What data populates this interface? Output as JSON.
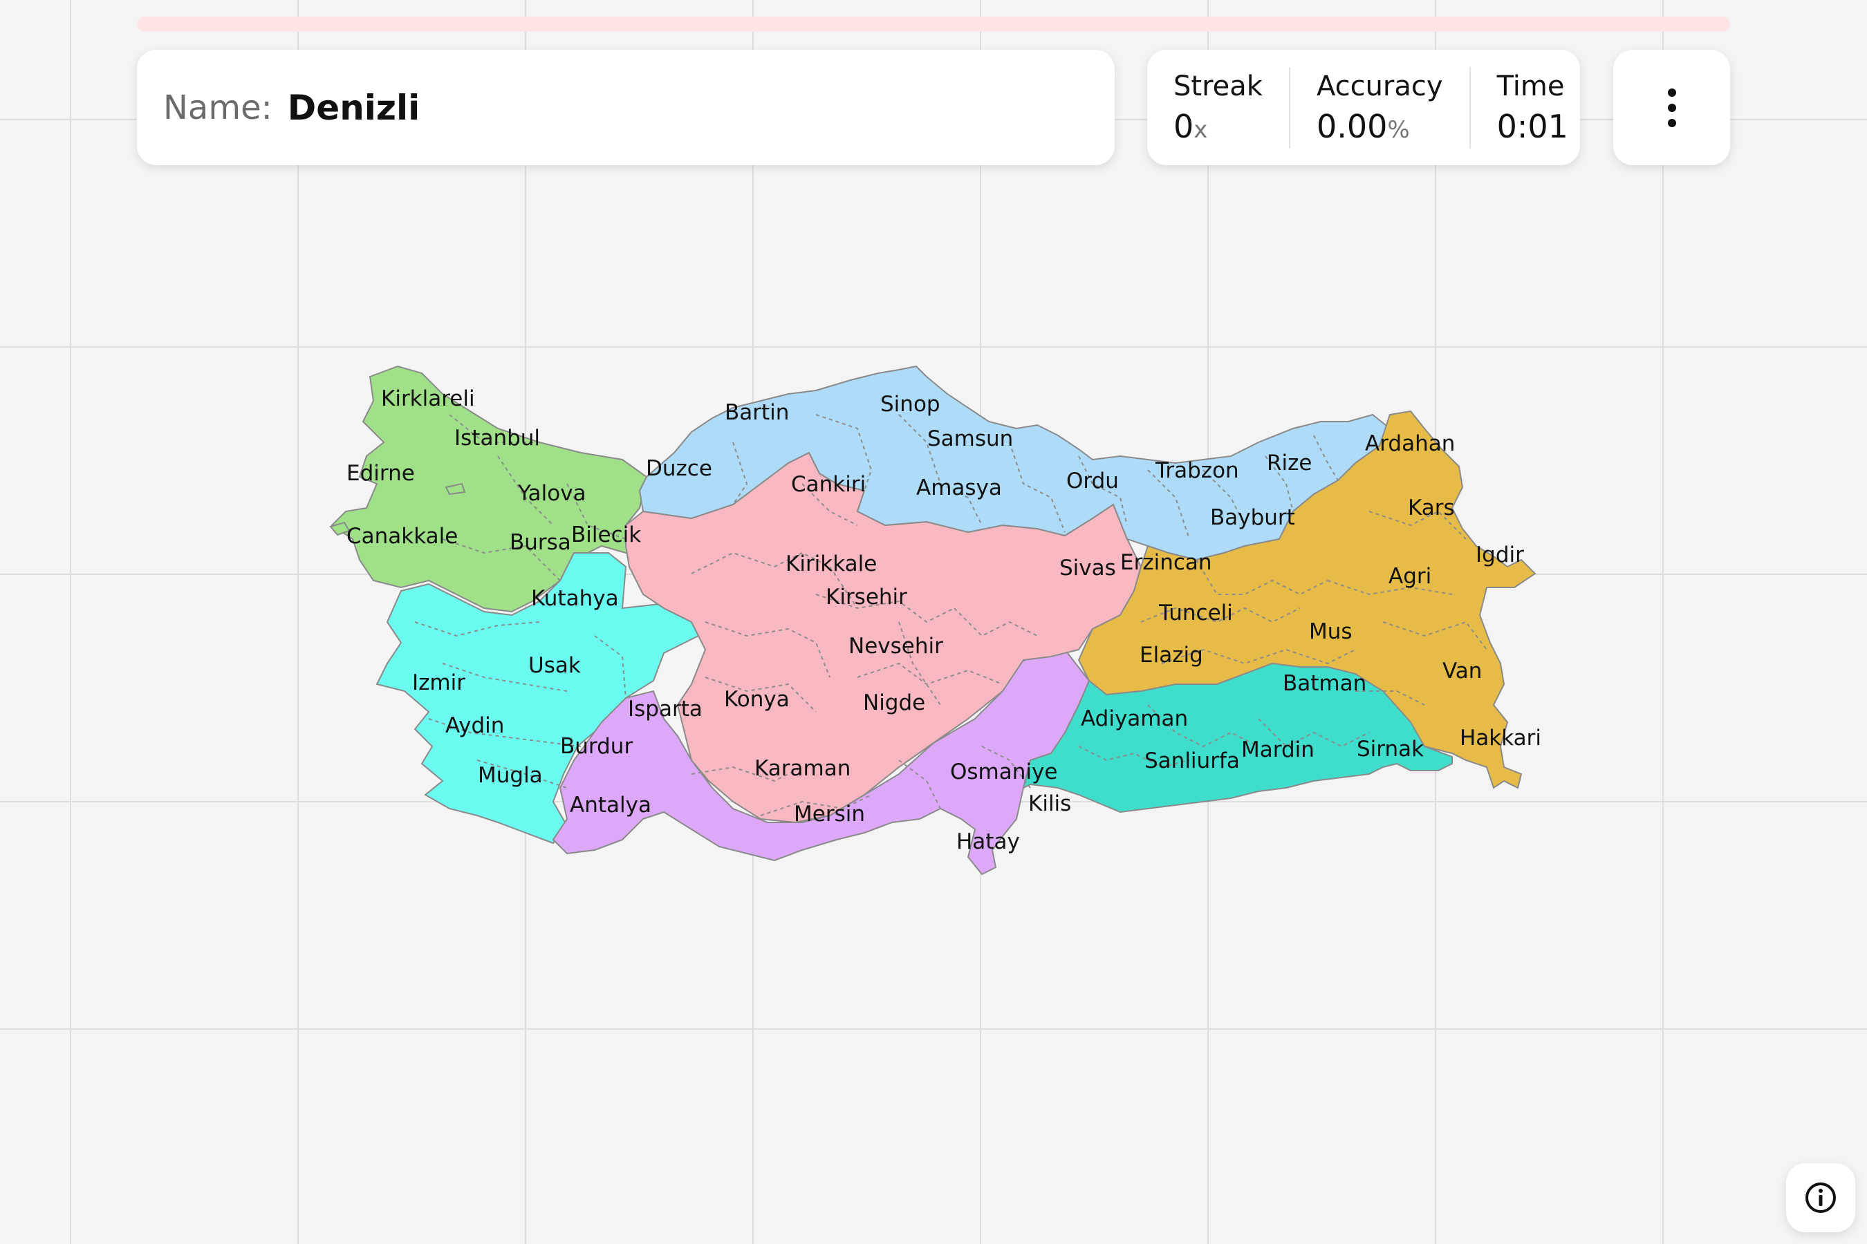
{
  "header": {
    "name_label": "Name:",
    "name_value": "Denizli"
  },
  "stats": {
    "streak_label": "Streak",
    "streak_value": "0",
    "streak_unit": "x",
    "accuracy_label": "Accuracy",
    "accuracy_value": "0.00",
    "accuracy_unit": "%",
    "time_label": "Time",
    "time_value": "0:01"
  },
  "quiz_progress": 0,
  "menu": {
    "icon": "vertical-dots-icon"
  },
  "info": {
    "icon": "info-icon"
  },
  "colors": {
    "marmara": "#9fe088",
    "aegean": "#6bfaf0",
    "central_anatolia": "#f8b8c1",
    "black_sea": "#aedcf8",
    "eastern_anatolia": "#e6bb47",
    "mediterranean": "#dca8f7",
    "southeastern_anatolia": "#3fddcc",
    "progress_track": "#ffe4e6"
  },
  "map": {
    "labels": {
      "kirklareli": "Kirklareli",
      "istanbul": "Istanbul",
      "edirne": "Edirne",
      "yalova": "Yalova",
      "canakkale": "Canakkale",
      "bursa": "Bursa",
      "bilecik": "Bilecik",
      "kutahya": "Kutahya",
      "usak": "Usak",
      "izmir": "Izmir",
      "aydin": "Aydin",
      "mugla": "Mugla",
      "burdur": "Burdur",
      "antalya": "Antalya",
      "isparta": "Isparta",
      "duzce": "Duzce",
      "bartin": "Bartin",
      "sinop": "Sinop",
      "samsun": "Samsun",
      "amasya": "Amasya",
      "ordu": "Ordu",
      "trabzon": "Trabzon",
      "rize": "Rize",
      "bayburt": "Bayburt",
      "ardahan": "Ardahan",
      "kars": "Kars",
      "igdir": "Igdir",
      "agri": "Agri",
      "erzincan": "Erzincan",
      "tunceli": "Tunceli",
      "elazig": "Elazig",
      "mus": "Mus",
      "van": "Van",
      "batman": "Batman",
      "hakkari": "Hakkari",
      "sirnak": "Sirnak",
      "mardin": "Mardin",
      "sanliurfa": "Sanliurfa",
      "adiyaman": "Adiyaman",
      "kilis": "Kilis",
      "hatay": "Hatay",
      "osmaniye": "Osmaniye",
      "mersin": "Mersin",
      "karaman": "Karaman",
      "konya": "Konya",
      "nigde": "Nigde",
      "nevsehir": "Nevsehir",
      "kirsehir": "Kirsehir",
      "kirikkale": "Kirikkale",
      "cankiri": "Cankiri",
      "sivas": "Sivas"
    }
  }
}
